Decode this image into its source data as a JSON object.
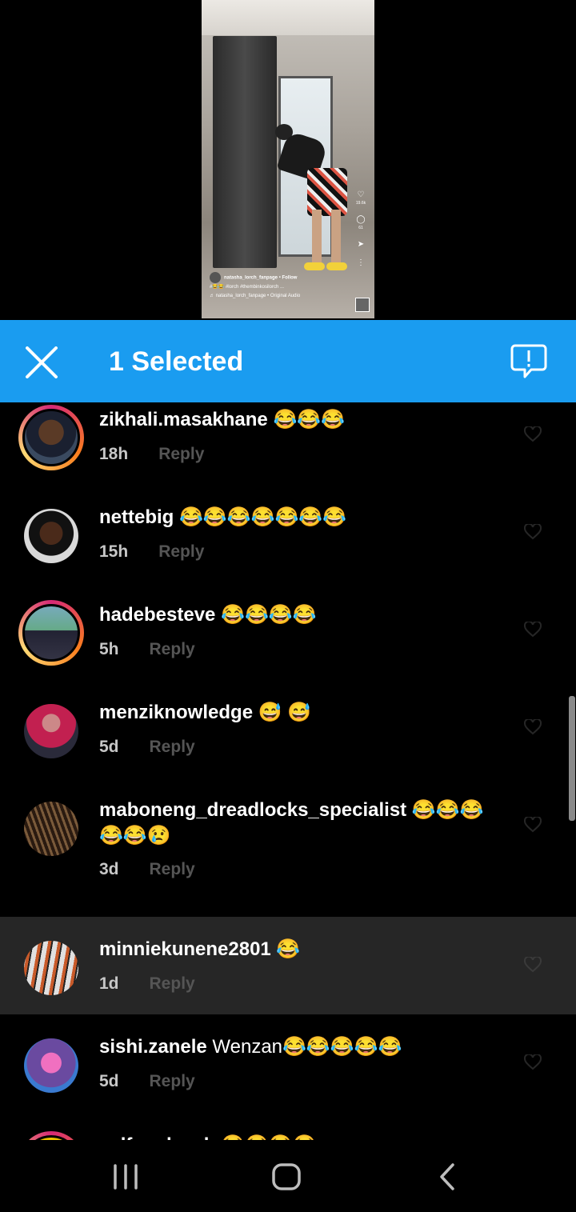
{
  "video": {
    "account": "natasha_lorch_fanpage",
    "follow": "Follow",
    "hashtags": "#😂😂 #lorch #thembinkosilorch ...",
    "audio": "natasha_lorch_fanpage • Original Audio",
    "likes": "19.6k",
    "comments_count": "61"
  },
  "selection_bar": {
    "title": "1 Selected",
    "color": "#1a9cf0"
  },
  "comments": [
    {
      "user": "zikhali.masakhane",
      "text": " 😂😂😂",
      "time": "18h",
      "reply": "Reply",
      "ring": true
    },
    {
      "user": "nettebig",
      "text": " 😂😂😂😂😂😂😂",
      "time": "15h",
      "reply": "Reply",
      "ring": false
    },
    {
      "user": "hadebesteve",
      "text": " 😂😂😂😂",
      "time": "5h",
      "reply": "Reply",
      "ring": true
    },
    {
      "user": "menziknowledge",
      "text": " 😅 😅",
      "time": "5d",
      "reply": "Reply",
      "ring": false
    },
    {
      "user": "maboneng_dreadlocks_specialist",
      "text": " 😂😂😂",
      "text2": "😂😂😢",
      "time": "3d",
      "reply": "Reply",
      "ring": false
    },
    {
      "user": "minniekunene2801",
      "text": " 😂",
      "time": "1d",
      "reply": "Reply",
      "ring": false,
      "selected": true
    },
    {
      "user": "sishi.zanele",
      "text": " Wenzan😂😂😂😂😂",
      "time": "5d",
      "reply": "Reply",
      "ring": false
    },
    {
      "user": "selfmadessb",
      "text": " 😂😂😂😂",
      "time": "",
      "reply": "",
      "ring": true
    }
  ]
}
